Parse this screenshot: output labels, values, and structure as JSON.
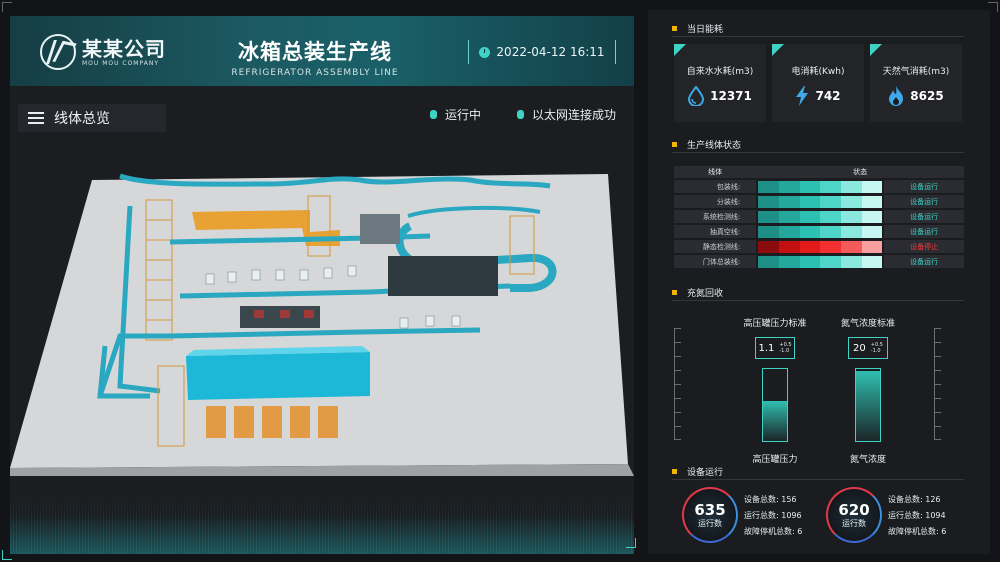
{
  "header": {
    "logo_cn": "某某公司",
    "logo_en": "MOU MOU COMPANY",
    "title_cn": "冰箱总装生产线",
    "title_en": "REFRIGERATOR ASSEMBLY LINE",
    "datetime": "2022-04-12  16:11"
  },
  "overview": {
    "label": "线体总览",
    "status_running": "运行中",
    "status_network": "以太网连接成功"
  },
  "energy": {
    "title": "当日能耗",
    "cards": [
      {
        "label": "自来水水耗(m3)",
        "value": "12371",
        "icon": "water-drop-icon"
      },
      {
        "label": "电消耗(Kwh)",
        "value": "742",
        "icon": "lightning-icon"
      },
      {
        "label": "天然气消耗(m3)",
        "value": "8625",
        "icon": "flame-icon"
      }
    ]
  },
  "line_status": {
    "title": "生产线体状态",
    "header_line": "线体",
    "header_status": "状态",
    "rows": [
      {
        "name": "包装线:",
        "status": "设备运行",
        "state": "run"
      },
      {
        "name": "分装线:",
        "status": "设备运行",
        "state": "run"
      },
      {
        "name": "系统检测线:",
        "status": "设备运行",
        "state": "run"
      },
      {
        "name": "抽真空线:",
        "status": "设备运行",
        "state": "run"
      },
      {
        "name": "静态检测线:",
        "status": "设备停止",
        "state": "stop"
      },
      {
        "name": "门体总装线:",
        "status": "设备运行",
        "state": "run"
      }
    ],
    "colors": {
      "run_text": "#3fd3c6",
      "stop_text": "#ff3a3a"
    }
  },
  "recovery": {
    "title": "充氮回收",
    "gauges": [
      {
        "title": "高压罐压力标准",
        "value": "1.1",
        "tol_plus": "+0.5",
        "tol_minus": "-1.0",
        "label": "高压罐压力",
        "level": 0.55
      },
      {
        "title": "氮气浓度标准",
        "value": "20",
        "tol_plus": "+0.5",
        "tol_minus": "-1.0",
        "label": "氮气浓度",
        "level": 0.97
      }
    ]
  },
  "equipment": {
    "title": "设备运行",
    "groups": [
      {
        "count": "635",
        "count_label": "运行数",
        "total": "设备总数:  156",
        "running": "运行总数:  1096",
        "fault": "故障停机总数:  6"
      },
      {
        "count": "620",
        "count_label": "运行数",
        "total": "设备总数:  126",
        "running": "运行总数:  1094",
        "fault": "故障停机总数:  6"
      }
    ]
  }
}
